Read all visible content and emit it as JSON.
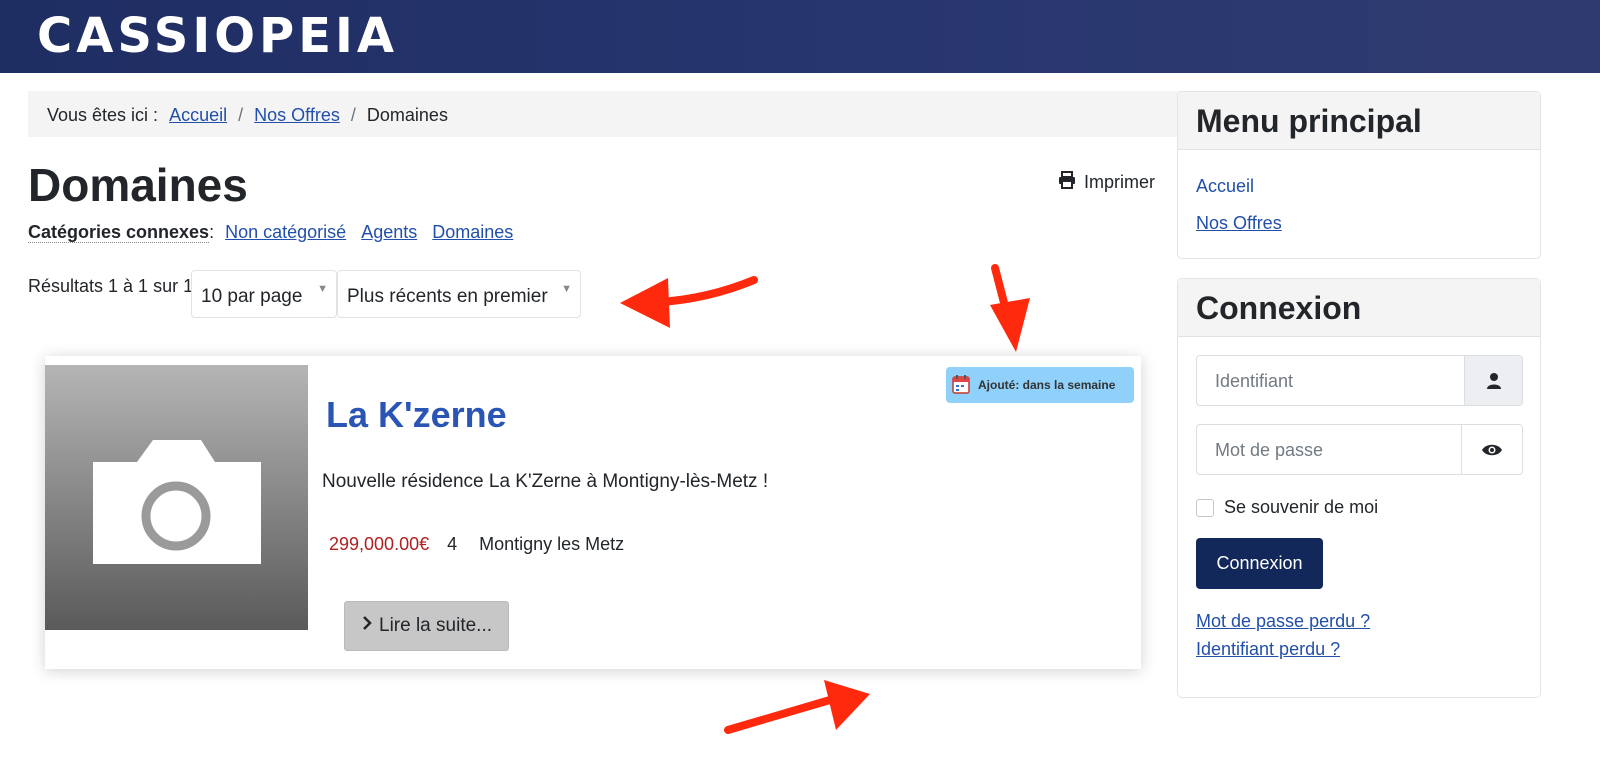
{
  "site": {
    "brand": "CASSIOPEIA"
  },
  "breadcrumb": {
    "prefix": "Vous êtes ici :",
    "items": [
      "Accueil",
      "Nos Offres",
      "Domaines"
    ],
    "separator": "/"
  },
  "page": {
    "title": "Domaines",
    "print_label": "Imprimer"
  },
  "related": {
    "label": "Catégories connexes",
    "links": [
      "Non catégorisé",
      "Agents",
      "Domaines"
    ]
  },
  "results": {
    "text": "Résultats 1 à 1 sur 1",
    "per_page": "10 par page",
    "order": "Plus récents en premier"
  },
  "listing": {
    "title": "La K'zerne",
    "badge": "Ajouté: dans la semaine",
    "intro": "Nouvelle résidence La K'Zerne à Montigny-lès-Metz !",
    "price": "299,000.00€",
    "rooms": "4",
    "city": "Montigny les Metz",
    "read_more": "Lire la suite..."
  },
  "sidebar": {
    "menu": {
      "title": "Menu principal",
      "items": [
        "Accueil",
        "Nos Offres"
      ]
    },
    "login": {
      "title": "Connexion",
      "username_placeholder": "Identifiant",
      "password_placeholder": "Mot de passe",
      "remember": "Se souvenir de moi",
      "submit": "Connexion",
      "lost_password": "Mot de passe perdu ?",
      "lost_username": "Identifiant perdu ?"
    }
  },
  "colors": {
    "header": "#1e2d62",
    "link": "#224faa",
    "price": "#b01f1f",
    "badge": "#8fd1fb",
    "button": "#13285a",
    "annotation_arrow": "#ff2a0e"
  }
}
